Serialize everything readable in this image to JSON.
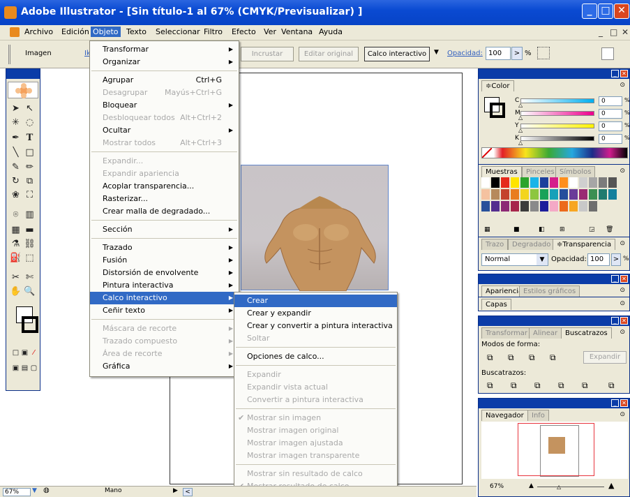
{
  "window": {
    "title": "Adobe Illustrator - [Sin título-1 al 67% (CMYK/Previsualizar) ]",
    "minimize": "_",
    "maximize": "□",
    "close": "✕"
  },
  "menubar": {
    "items": [
      "Archivo",
      "Edición",
      "Objeto",
      "Texto",
      "Seleccionar",
      "Filtro",
      "Efecto",
      "Ver",
      "Ventana",
      "Ayuda"
    ],
    "active": "Objeto",
    "doc_controls": [
      "_",
      "□",
      "✕"
    ]
  },
  "control_bar": {
    "label": "Imagen",
    "link_fragment": "Ik",
    "embed_button": "Incrustar",
    "edit_original_button": "Editar original",
    "live_trace_button": "Calco interactivo",
    "opacity_label": "Opacidad:",
    "opacity_value": "100",
    "percent": "%"
  },
  "objeto_menu": {
    "items": [
      {
        "label": "Transformar",
        "shortcut": "",
        "submenu": true,
        "enabled": true
      },
      {
        "label": "Organizar",
        "shortcut": "",
        "submenu": true,
        "enabled": true
      },
      {
        "sep": true
      },
      {
        "label": "Agrupar",
        "shortcut": "Ctrl+G",
        "submenu": false,
        "enabled": true
      },
      {
        "label": "Desagrupar",
        "shortcut": "Mayús+Ctrl+G",
        "submenu": false,
        "enabled": false
      },
      {
        "label": "Bloquear",
        "shortcut": "",
        "submenu": true,
        "enabled": true
      },
      {
        "label": "Desbloquear todos",
        "shortcut": "Alt+Ctrl+2",
        "submenu": false,
        "enabled": false
      },
      {
        "label": "Ocultar",
        "shortcut": "",
        "submenu": true,
        "enabled": true
      },
      {
        "label": "Mostrar todos",
        "shortcut": "Alt+Ctrl+3",
        "submenu": false,
        "enabled": false
      },
      {
        "sep": true
      },
      {
        "label": "Expandir...",
        "shortcut": "",
        "submenu": false,
        "enabled": false
      },
      {
        "label": "Expandir apariencia",
        "shortcut": "",
        "submenu": false,
        "enabled": false
      },
      {
        "label": "Acoplar transparencia...",
        "shortcut": "",
        "submenu": false,
        "enabled": true
      },
      {
        "label": "Rasterizar...",
        "shortcut": "",
        "submenu": false,
        "enabled": true
      },
      {
        "label": "Crear malla de degradado...",
        "shortcut": "",
        "submenu": false,
        "enabled": true
      },
      {
        "sep": true
      },
      {
        "label": "Sección",
        "shortcut": "",
        "submenu": true,
        "enabled": true
      },
      {
        "sep": true
      },
      {
        "label": "Trazado",
        "shortcut": "",
        "submenu": true,
        "enabled": true
      },
      {
        "label": "Fusión",
        "shortcut": "",
        "submenu": true,
        "enabled": true
      },
      {
        "label": "Distorsión de envolvente",
        "shortcut": "",
        "submenu": true,
        "enabled": true
      },
      {
        "label": "Pintura interactiva",
        "shortcut": "",
        "submenu": true,
        "enabled": true
      },
      {
        "label": "Calco interactivo",
        "shortcut": "",
        "submenu": true,
        "enabled": true,
        "highlighted": true
      },
      {
        "label": "Ceñir texto",
        "shortcut": "",
        "submenu": true,
        "enabled": true
      },
      {
        "sep": true
      },
      {
        "label": "Máscara de recorte",
        "shortcut": "",
        "submenu": true,
        "enabled": false
      },
      {
        "label": "Trazado compuesto",
        "shortcut": "",
        "submenu": true,
        "enabled": false
      },
      {
        "label": "Área de recorte",
        "shortcut": "",
        "submenu": true,
        "enabled": false
      },
      {
        "label": "Gráfica",
        "shortcut": "",
        "submenu": true,
        "enabled": true
      }
    ]
  },
  "calco_submenu": {
    "items": [
      {
        "label": "Crear",
        "enabled": true,
        "highlighted": true
      },
      {
        "label": "Crear y expandir",
        "enabled": true
      },
      {
        "label": "Crear y convertir a pintura interactiva",
        "enabled": true
      },
      {
        "label": "Soltar",
        "enabled": false
      },
      {
        "sep": true
      },
      {
        "label": "Opciones de calco...",
        "enabled": true
      },
      {
        "sep": true
      },
      {
        "label": "Expandir",
        "enabled": false
      },
      {
        "label": "Expandir vista actual",
        "enabled": false
      },
      {
        "label": "Convertir a pintura interactiva",
        "enabled": false
      },
      {
        "sep": true
      },
      {
        "label": "Mostrar sin imagen",
        "enabled": false,
        "checked": true
      },
      {
        "label": "Mostrar imagen original",
        "enabled": false
      },
      {
        "label": "Mostrar imagen ajustada",
        "enabled": false
      },
      {
        "label": "Mostrar imagen transparente",
        "enabled": false
      },
      {
        "sep": true
      },
      {
        "label": "Mostrar sin resultado de calco",
        "enabled": false
      },
      {
        "label": "Mostrar resultado de calco",
        "enabled": false,
        "checked": true
      }
    ]
  },
  "color_panel": {
    "tab": "≑Color",
    "channels": [
      {
        "name": "C",
        "value": "0"
      },
      {
        "name": "M",
        "value": "0"
      },
      {
        "name": "Y",
        "value": "0"
      },
      {
        "name": "K",
        "value": "0"
      }
    ],
    "pct": "%"
  },
  "swatches_panel": {
    "tabs": [
      "Muestras",
      "Pinceles",
      "Símbolos"
    ],
    "colors": [
      "#ffffff",
      "#000000",
      "#e52a1c",
      "#ffe400",
      "#2da42c",
      "#1ab4e8",
      "#1c3f9c",
      "#d51f8b",
      "#ff8f1c",
      "#ffffff",
      "#cfcfcf",
      "#a6a6a6",
      "#7c7c7c",
      "#555555",
      "#f5c2a0",
      "#b68a5c",
      "#c4432c",
      "#e97d1f",
      "#f3d51e",
      "#8dc63f",
      "#19a259",
      "#17a1b9",
      "#264e9c",
      "#6a3c99",
      "#9a2b73",
      "#3b8f52",
      "#1f7b6f",
      "#147f9d",
      "#28519b",
      "#542e8f",
      "#8d2975",
      "#a7264b",
      "#3c3c3c",
      "#8a8a8a",
      "#1d1d9b",
      "#f4a9c6",
      "#ec6a1c",
      "#f7a621",
      "#c8c8c8",
      "#6e6e6e"
    ]
  },
  "transparency_panel": {
    "tabs": [
      "Trazo",
      "Degradado",
      "≑Transparencia"
    ],
    "mode": "Normal",
    "opacity_label": "Opacidad:",
    "opacity_value": "100",
    "pct": "%"
  },
  "appearance_panel": {
    "tabs": [
      "Apariencia",
      "Estilos gráficos"
    ]
  },
  "layers_panel": {
    "tabs": [
      "Capas"
    ]
  },
  "pathfinder_panel": {
    "tabs": [
      "Transformar",
      "Alinear",
      "Buscatrazos"
    ],
    "shape_modes_label": "Modos de forma:",
    "expand_button": "Expandir",
    "pathfinder_label": "Buscatrazos:"
  },
  "navigator_panel": {
    "tabs": [
      "Navegador",
      "Info"
    ],
    "zoom": "67%"
  },
  "status_bar": {
    "zoom": "67%",
    "tool_name": "Mano"
  },
  "colors": {
    "titlebar": "#0a4ad2",
    "menu_highlight": "#316ac5",
    "panel_bg": "#ece9d8",
    "navigator_frame": "#e8343d"
  }
}
